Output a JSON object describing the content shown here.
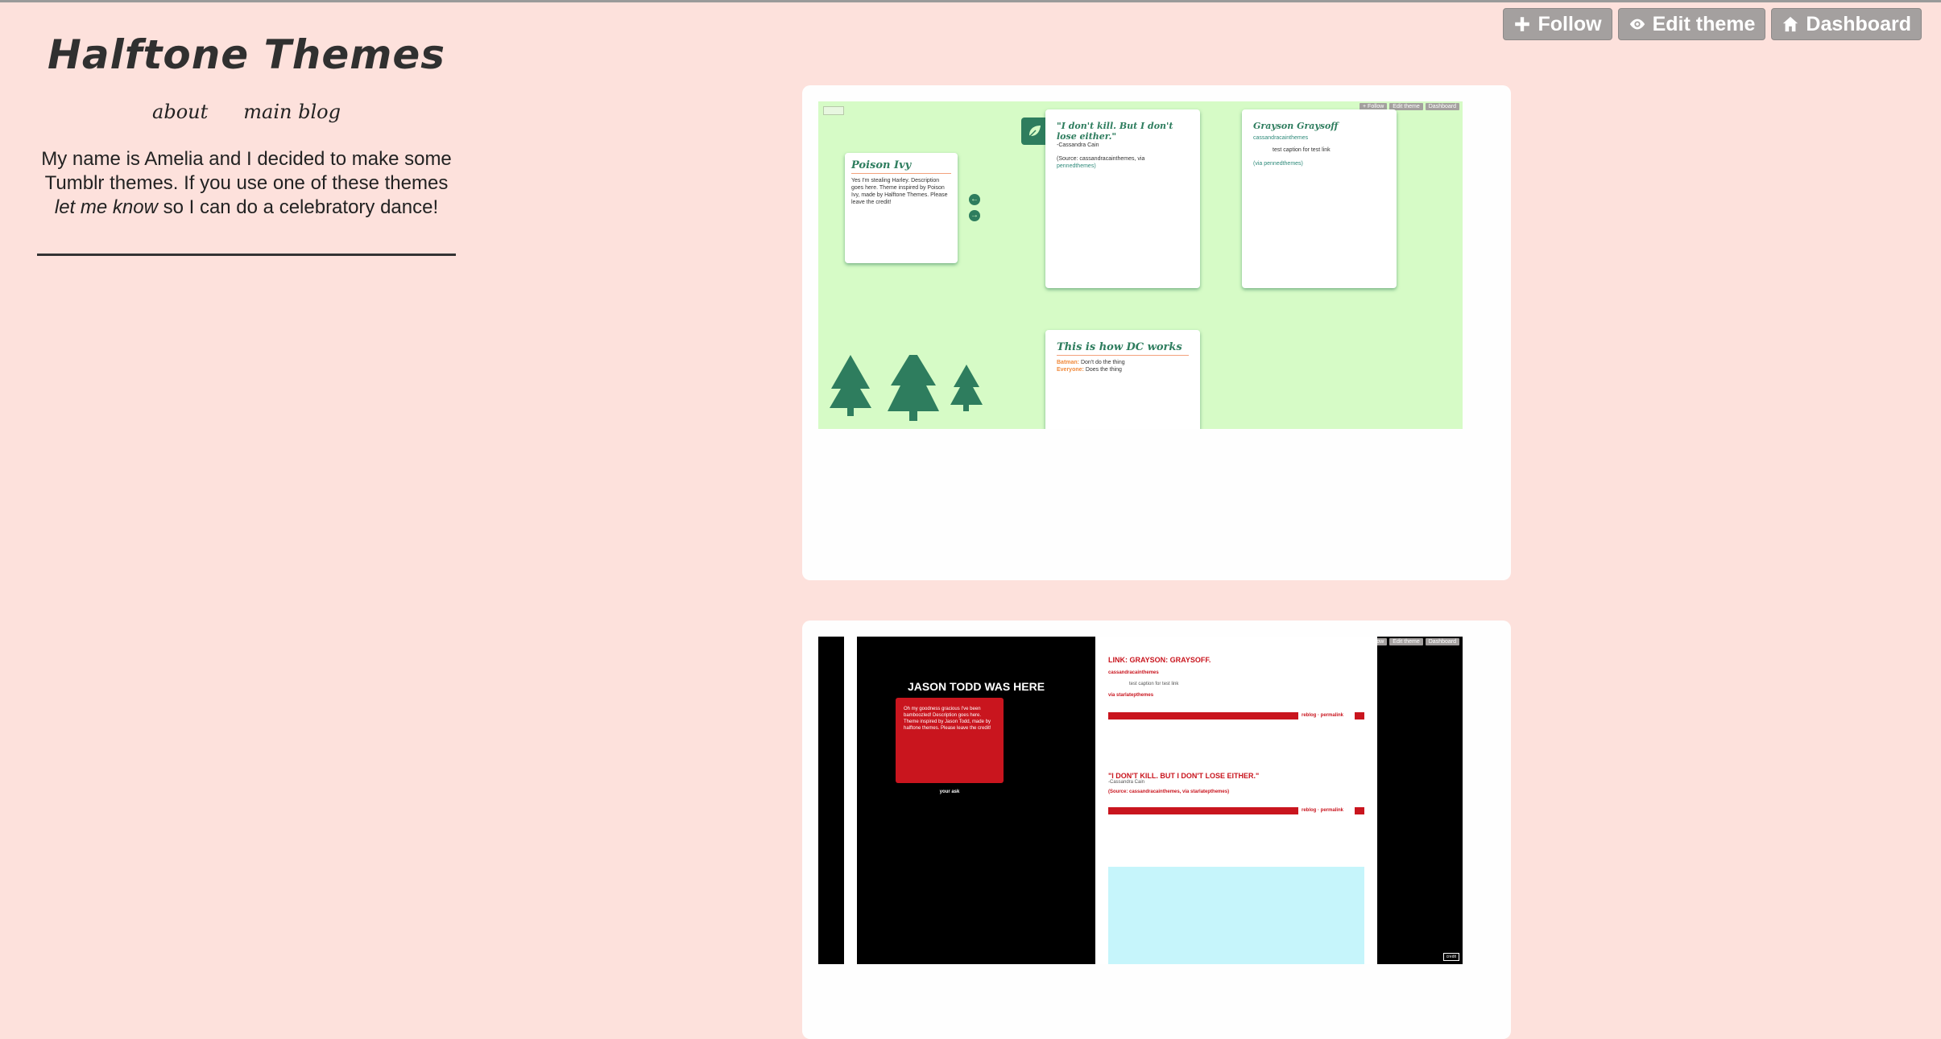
{
  "controls": {
    "follow": "Follow",
    "edit_theme": "Edit theme",
    "dashboard": "Dashboard"
  },
  "sidebar": {
    "title": "Halftone Themes",
    "nav": [
      "about",
      "main blog"
    ],
    "bio_line1": "My name is Amelia and I decided to make some Tumblr themes. If you use one of these themes",
    "bio_em": "let me know",
    "bio_line2": "so I can do a celebratory dance!"
  },
  "post1": {
    "mini_controls": [
      "+ Follow",
      "Edit theme",
      "Dashboard"
    ],
    "card_poison_title": "Poison Ivy",
    "card_poison_text": "Yes I'm stealing Harley. Description goes here. Theme inspired by Poison Ivy, made by Halftone Themes. Please leave the credit!",
    "card_quote_title": "\"I don't kill. But I don't lose either.\"",
    "card_quote_author": "-Cassandra Cain",
    "card_quote_source": "(Source: cassandracainthemes, via",
    "card_quote_via": "pennedthemes)",
    "card_grayson_title": "Grayson Graysoff",
    "card_grayson_link": "cassandracainthemes",
    "card_grayson_caption": "test caption for test link",
    "card_grayson_via": "(via pennedthemes)",
    "card_dc_title": "This is how DC works",
    "card_dc_line1_name": "Batman:",
    "card_dc_line1": "Don't do the thing",
    "card_dc_line2_name": "Everyone:",
    "card_dc_line2": "Does the thing"
  },
  "post2": {
    "mini_controls": [
      "+ Follow",
      "Edit theme",
      "Dashboard"
    ],
    "sidebar_title": "JASON TODD WAS HERE",
    "sidebar_text": "Oh my goodness gracious I've been bamboozled! Description goes here. Theme inspired by Jason Todd, made by halftone themes. Please leave the credit!",
    "sidebar_link": "your ask",
    "post_a_title": "LINK: GRAYSON: GRAYSOFF.",
    "post_a_source": "cassandracainthemes",
    "post_a_caption": "test caption for test link",
    "post_a_via": "via starlatepthemes",
    "post_a_meta": "reblog · permalink",
    "post_b_title": "\"I DON'T KILL. BUT I DON'T LOSE EITHER.\"",
    "post_b_author": "-Cassandra Cain",
    "post_b_source": "(Source: cassandracainthemes, via starlatepthemes)",
    "post_b_meta": "reblog · permalink",
    "corner_badge": "credit"
  },
  "colors": {
    "page_bg": "#fde1dc",
    "green_preview_bg": "#d6fbc6",
    "green_accent": "#2e7d5e",
    "red_accent": "#c9151e",
    "cyan_block": "#c6f5fb"
  }
}
